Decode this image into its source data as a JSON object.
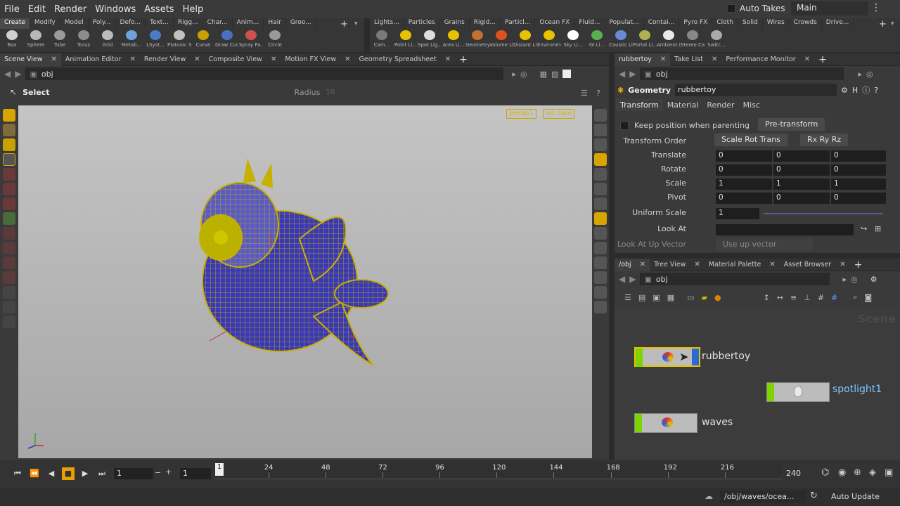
{
  "menubar": {
    "items": [
      "File",
      "Edit",
      "Render",
      "Windows",
      "Assets",
      "Help"
    ],
    "auto_takes": "Auto Takes",
    "desktop": "Main"
  },
  "shelf_left": {
    "tabs": [
      "Create",
      "Modify",
      "Model",
      "Poly...",
      "Defo...",
      "Text...",
      "Rigg...",
      "Char...",
      "Anim...",
      "Hair",
      "Groo..."
    ],
    "tools": [
      "Box",
      "Sphere",
      "Tube",
      "Torus",
      "Grid",
      "Metab...",
      "LSyst...",
      "Platonic Sol...",
      "Curve",
      "Draw Cur...",
      "Spray Pa...",
      "Circle"
    ]
  },
  "shelf_right": {
    "tabs": [
      "Lights...",
      "Particles",
      "Grains",
      "Rigid...",
      "Particl...",
      "Ocean FX",
      "Fluid...",
      "Populat...",
      "Contai...",
      "Pyro FX",
      "Cloth",
      "Solid",
      "Wires",
      "Crowds",
      "Drive..."
    ],
    "tools": [
      "Cam...",
      "Point Li...",
      "Spot Lig...",
      "Area Li...",
      "Geometry L...",
      "Volume Li...",
      "Distant Li...",
      "Environme...",
      "Sky Li...",
      "GI Li...",
      "Caustic Lig...",
      "Portal Li...",
      "Ambient Li...",
      "Stereo Cam...",
      "Switc..."
    ]
  },
  "viewer": {
    "tabs": [
      "Scene View",
      "Animation Editor",
      "Render View",
      "Composite View",
      "Motion FX View",
      "Geometry Spreadsheet"
    ],
    "path": "obj",
    "tool_label": "Select",
    "radius_label": "Radius",
    "radius_value": "10",
    "camera": "persp1",
    "cam_menu": "no cam"
  },
  "params": {
    "tabs": [
      "rubbertoy",
      "Take List",
      "Performance Monitor"
    ],
    "path": "obj",
    "node_type": "Geometry",
    "node_name": "rubbertoy",
    "subtabs": [
      "Transform",
      "Material",
      "Render",
      "Misc"
    ],
    "keep_position": "Keep position when parenting",
    "pre_transform": "Pre-transform",
    "transform_order_label": "Transform Order",
    "transform_order": "Scale Rot Trans",
    "rot_order": "Rx Ry Rz",
    "translate_label": "Translate",
    "translate": [
      "0",
      "0",
      "0"
    ],
    "rotate_label": "Rotate",
    "rotate": [
      "0",
      "0",
      "0"
    ],
    "scale_label": "Scale",
    "scale": [
      "1",
      "1",
      "1"
    ],
    "pivot_label": "Pivot",
    "pivot": [
      "0",
      "0",
      "0"
    ],
    "uniform_scale_label": "Uniform Scale",
    "uniform_scale": "1",
    "look_at_label": "Look At",
    "look_at_up_label": "Look At Up Vector",
    "look_at_up": "Use up vector"
  },
  "network": {
    "tabs": [
      "/obj",
      "Tree View",
      "Material Palette",
      "Asset Browser"
    ],
    "path": "obj",
    "watermark": "Scene",
    "nodes": [
      "rubbertoy",
      "spotlight1",
      "waves"
    ]
  },
  "timeline": {
    "current_frame": "1",
    "start_frame": "1",
    "ticks": [
      "24",
      "48",
      "72",
      "96",
      "120",
      "144",
      "168",
      "192",
      "216"
    ],
    "marker": "1",
    "end_frame": "240"
  },
  "status": {
    "path": "/obj/waves/ocea...",
    "auto_update": "Auto Update"
  },
  "colors": {
    "accent": "#7cd400",
    "selected": "#e8c200"
  }
}
